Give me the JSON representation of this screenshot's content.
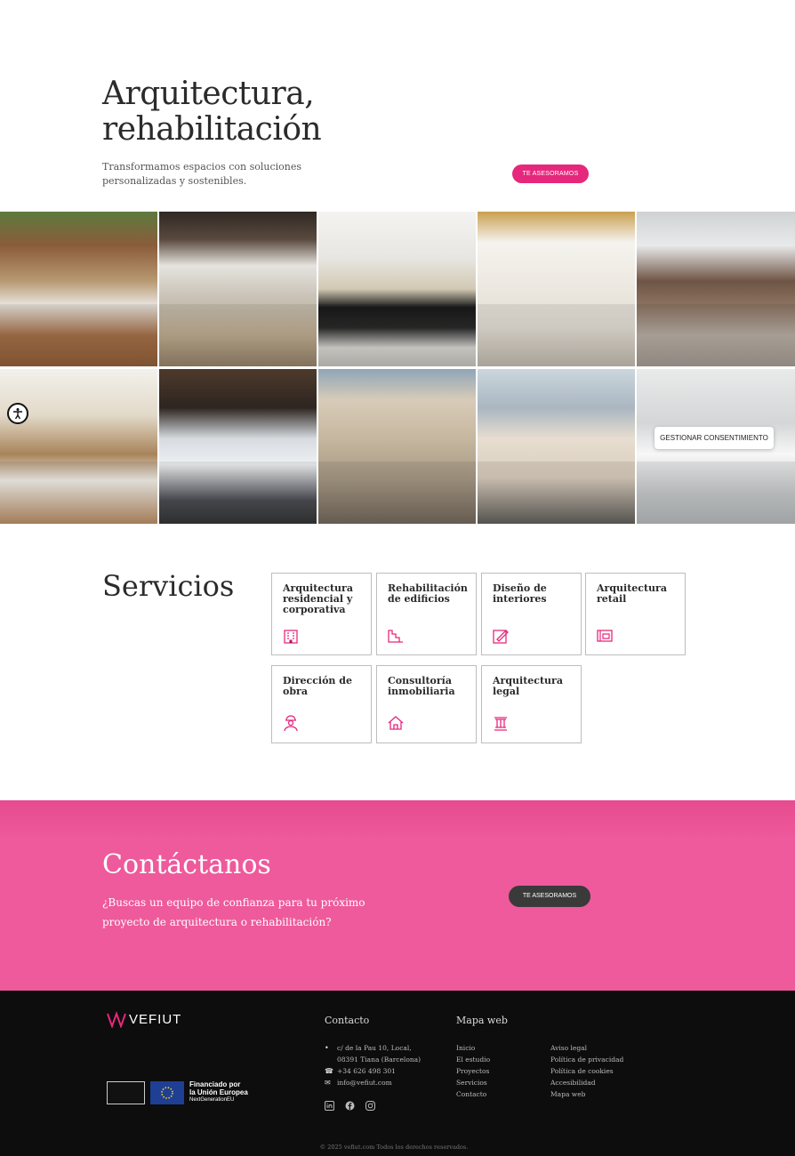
{
  "hero": {
    "title_line1": "Arquitectura,",
    "title_line2": "rehabilitación",
    "subtitle": "Transformamos espacios con soluciones personalizadas y sostenibles.",
    "cta": "TE ASESORAMOS"
  },
  "gallery": {
    "tiles": [
      "cafe-interior-photo",
      "shop-aisle-photo",
      "grocery-store-photo",
      "building-hallway-photo",
      "office-reception-photo",
      "restaurant-interior-photo",
      "car-showroom-photo",
      "facade-photo",
      "balcony-building-photo",
      "office-interior-photo"
    ]
  },
  "accessibility": {
    "icon": "accessibility-icon"
  },
  "consent": {
    "label": "GESTIONAR CONSENTIMIENTO"
  },
  "services": {
    "title": "Servicios",
    "items": [
      {
        "label": "Arquitectura residencial y corporativa",
        "icon": "building-icon"
      },
      {
        "label": "Rehabilitación de edificios",
        "icon": "stairs-icon"
      },
      {
        "label": "Diseño de interiores",
        "icon": "design-pencil-icon"
      },
      {
        "label": "Arquitectura retail",
        "icon": "blueprint-icon"
      },
      {
        "label": "Dirección de obra",
        "icon": "worker-icon"
      },
      {
        "label": "Consultoría inmobiliaria",
        "icon": "house-icon"
      },
      {
        "label": "Arquitectura legal",
        "icon": "column-icon"
      }
    ]
  },
  "contact": {
    "title": "Contáctanos",
    "subtitle": "¿Buscas un equipo de confianza para tu próximo proyecto de arquitectura o rehabilitación?",
    "cta": "TE ASESORAMOS"
  },
  "footer": {
    "logo_text": "VEFIUT",
    "eu_line1": "Financiado por",
    "eu_line2": "la Unión Europea",
    "eu_line3": "NextGenerationEU",
    "contact_heading": "Contacto",
    "address_line1": "c/ de la Pau 10, Local,",
    "address_line2": "08391 Tiana (Barcelona)",
    "phone": "+34 626 498 301",
    "email": "info@vefiut.com",
    "sitemap_heading": "Mapa web",
    "links_col1": [
      "Inicio",
      "El estudio",
      "Proyectos",
      "Servicios",
      "Contacto"
    ],
    "links_col2": [
      "Aviso legal",
      "Política de privacidad",
      "Política de cookies",
      "Accesibilidad",
      "Mapa web"
    ],
    "social": [
      "linkedin-icon",
      "facebook-icon",
      "instagram-icon"
    ],
    "copyright": "© 2025 vefiut.com Todos los derechos reservados."
  },
  "colors": {
    "accent": "#e6287c",
    "band": "#ee5a9c",
    "footer": "#0d0d0d"
  }
}
